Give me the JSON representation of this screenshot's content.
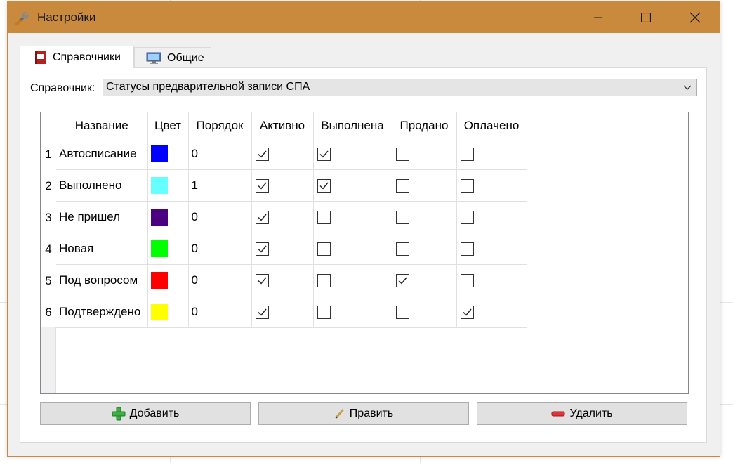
{
  "window": {
    "title": "Настройки",
    "accent_color": "#c98a3d",
    "controls": [
      "minimize-icon",
      "maximize-icon",
      "close-icon"
    ]
  },
  "tabs": [
    {
      "label": "Справочники",
      "icon": "book-icon",
      "active": true
    },
    {
      "label": "Общие",
      "icon": "monitor-icon",
      "active": false
    }
  ],
  "reference": {
    "label": "Справочник:",
    "selected": "Статусы предварительной записи СПА"
  },
  "grid": {
    "columns": [
      "Название",
      "Цвет",
      "Порядок",
      "Активно",
      "Выполнена",
      "Продано",
      "Оплачено"
    ],
    "rows": [
      {
        "num": "1",
        "name": "Автосписание",
        "color": "#0000ff",
        "order": "0",
        "active": true,
        "done": true,
        "sold": false,
        "paid": false
      },
      {
        "num": "2",
        "name": "Выполнено",
        "color": "#66ffff",
        "order": "1",
        "active": true,
        "done": true,
        "sold": false,
        "paid": false
      },
      {
        "num": "3",
        "name": "Не пришел",
        "color": "#4b0082",
        "order": "0",
        "active": true,
        "done": false,
        "sold": false,
        "paid": false
      },
      {
        "num": "4",
        "name": "Новая",
        "color": "#00ff00",
        "order": "0",
        "active": true,
        "done": false,
        "sold": false,
        "paid": false
      },
      {
        "num": "5",
        "name": "Под вопросом",
        "color": "#ff0000",
        "order": "0",
        "active": true,
        "done": false,
        "sold": true,
        "paid": false
      },
      {
        "num": "6",
        "name": "Подтверждено",
        "color": "#ffff00",
        "order": "0",
        "active": true,
        "done": false,
        "sold": false,
        "paid": true
      }
    ]
  },
  "buttons": {
    "add": {
      "label": "Добавить",
      "icon": "plus-icon"
    },
    "edit": {
      "label": "Править",
      "icon": "pencil-icon"
    },
    "delete": {
      "label": "Удалить",
      "icon": "minus-icon"
    }
  }
}
